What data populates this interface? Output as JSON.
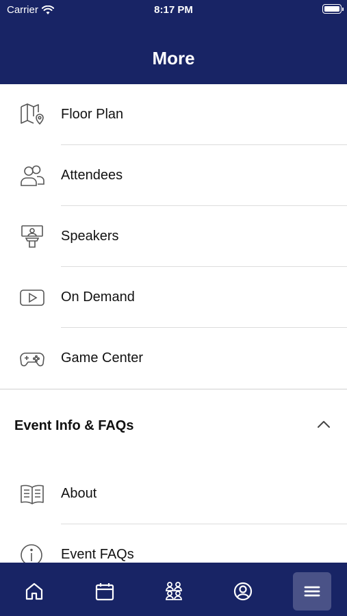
{
  "status_bar": {
    "carrier": "Carrier",
    "time": "8:17 PM"
  },
  "header": {
    "title": "More"
  },
  "menu_items": [
    {
      "label": "Floor Plan",
      "icon": "map-pin-icon"
    },
    {
      "label": "Attendees",
      "icon": "people-icon"
    },
    {
      "label": "Speakers",
      "icon": "podium-icon"
    },
    {
      "label": "On Demand",
      "icon": "video-play-icon"
    },
    {
      "label": "Game Center",
      "icon": "gamepad-icon"
    }
  ],
  "section": {
    "title": "Event Info & FAQs",
    "expanded": true
  },
  "section_items": [
    {
      "label": "About",
      "icon": "book-icon"
    },
    {
      "label": "Event FAQs",
      "icon": "info-icon"
    }
  ],
  "tabbar": {
    "tabs": [
      {
        "name": "home",
        "icon": "home-icon"
      },
      {
        "name": "agenda",
        "icon": "calendar-icon"
      },
      {
        "name": "attendees",
        "icon": "group-icon"
      },
      {
        "name": "profile",
        "icon": "user-circle-icon"
      },
      {
        "name": "more",
        "icon": "menu-icon",
        "active": true
      }
    ]
  },
  "colors": {
    "brand": "#182465",
    "active_tab": "#4a5287",
    "divider": "#dcdcdc"
  }
}
